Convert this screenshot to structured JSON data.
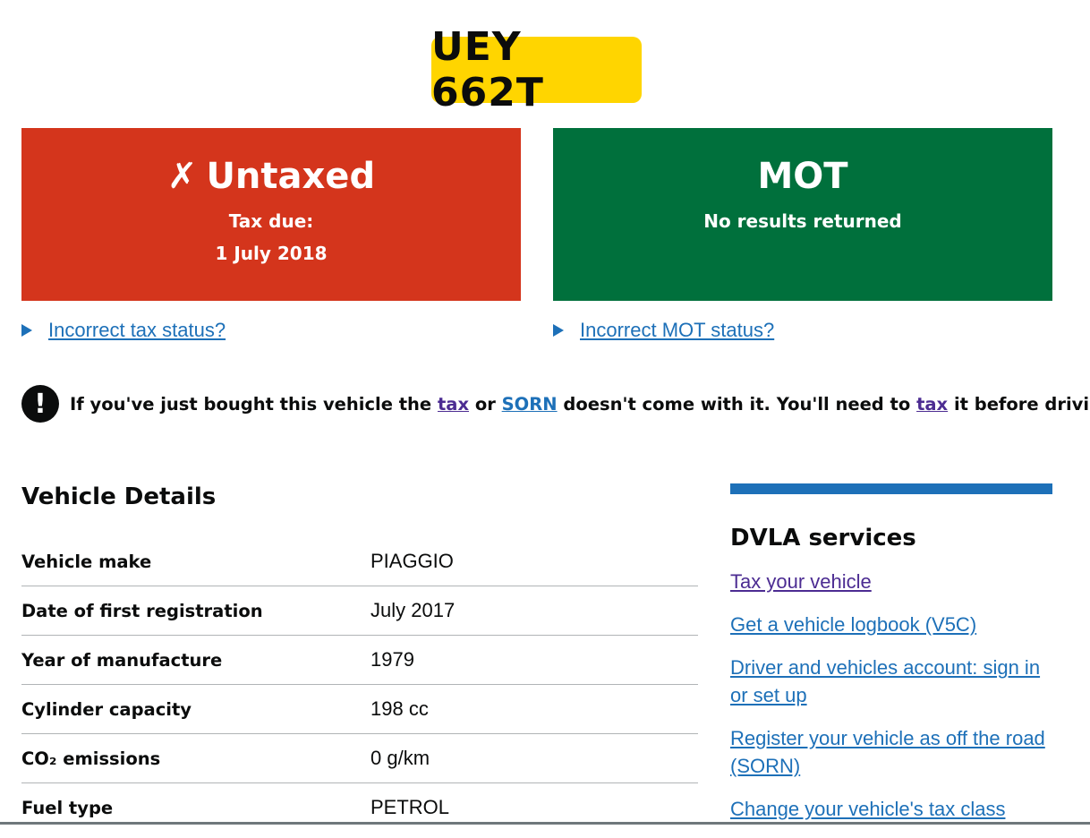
{
  "plate": "UEY 662T",
  "tax_panel": {
    "icon": "cross-icon",
    "cross": "✗",
    "status": "Untaxed",
    "due_label": "Tax due:",
    "due_date": "1 July 2018"
  },
  "mot_panel": {
    "status": "MOT",
    "message": "No results returned"
  },
  "tax_details_link": "Incorrect tax status?",
  "mot_details_link": "Incorrect MOT status?",
  "warning": {
    "icon": "exclamation-icon",
    "symbol": "!",
    "part1": "If you've just bought this vehicle the",
    "link_tax": "tax",
    "word_or": "or",
    "link_sorn": "SORN",
    "part2": "doesn't come with it. You'll need to",
    "link_tax2": "tax",
    "part3": "it before driving it."
  },
  "vehicle_details": {
    "title": "Vehicle Details",
    "rows": [
      {
        "label": "Vehicle make",
        "value": "PIAGGIO"
      },
      {
        "label": "Date of first registration",
        "value": "July 2017"
      },
      {
        "label": "Year of manufacture",
        "value": "1979"
      },
      {
        "label": "Cylinder capacity",
        "value": "198 cc"
      },
      {
        "label": "CO₂ emissions",
        "value": "0 g/km"
      },
      {
        "label": "Fuel type",
        "value": "PETROL"
      }
    ]
  },
  "dvla_services": {
    "title": "DVLA services",
    "links": [
      "Tax your vehicle",
      "Get a vehicle logbook (V5C)",
      "Driver and vehicles account: sign in or set up",
      "Register your vehicle as off the road (SORN)",
      "Change your vehicle's tax class"
    ]
  },
  "colors": {
    "plate": "#ffd500",
    "untaxed": "#d4351c",
    "mot": "#00703c",
    "link": "#1d70b8",
    "visited_link": "#4c2c92"
  }
}
